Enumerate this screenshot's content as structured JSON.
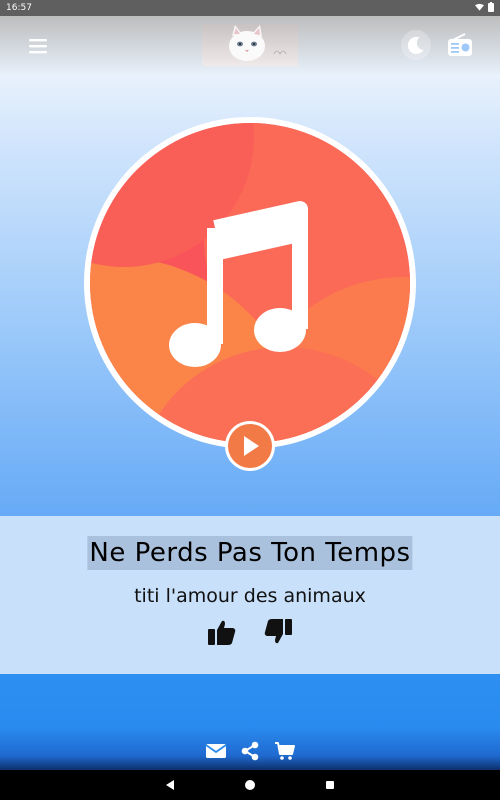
{
  "status_bar": {
    "time": "16:57",
    "icons": [
      "wifi-icon",
      "battery-icon"
    ]
  },
  "header": {
    "menu_icon": "hamburger-menu-icon",
    "logo_icon": "cat-logo",
    "night_mode_icon": "moon-icon",
    "radio_icon": "radio-icon"
  },
  "player": {
    "cover_icon": "music-note-icon",
    "play_icon": "play-icon",
    "song_title": "Ne Perds Pas Ton Temps",
    "artist": "titi l'amour des animaux",
    "like_icon": "thumbs-up-icon",
    "dislike_icon": "thumbs-down-icon"
  },
  "footer": {
    "icons": [
      "email-icon",
      "share-icon",
      "cart-icon"
    ]
  },
  "nav": {
    "icons": [
      "back-icon",
      "home-icon",
      "recents-icon"
    ]
  },
  "colors": {
    "accent_orange": "#f37a4a",
    "cover_red": "#f9545a",
    "panel_bg": "#c8e0fa",
    "footer_blue": "#2e8ff2"
  }
}
